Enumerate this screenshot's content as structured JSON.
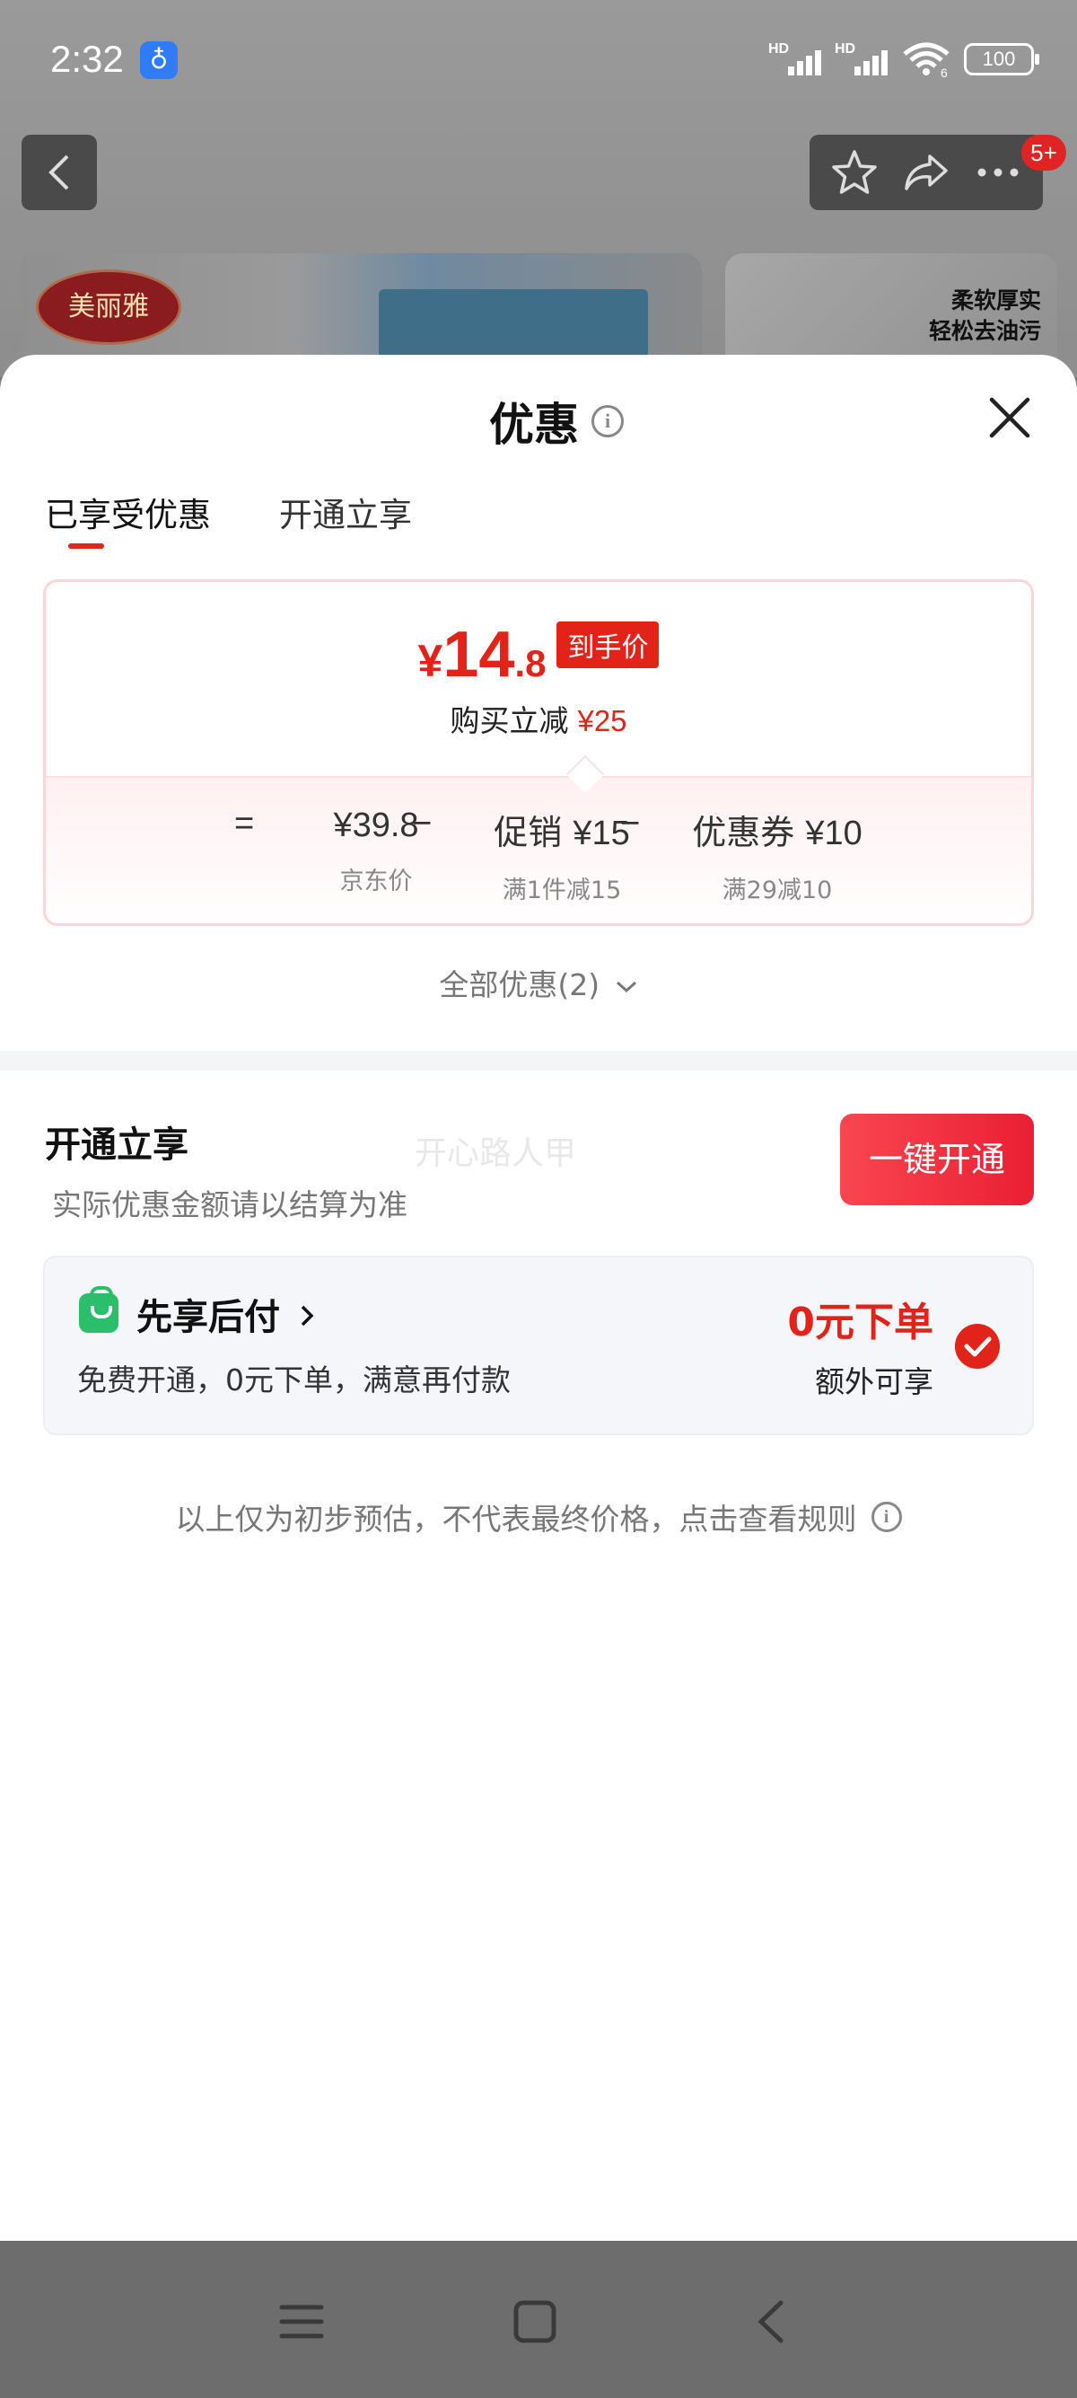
{
  "status_bar": {
    "time": "2:32",
    "app_icon": "shield-app-icon",
    "signal1_label": "HD",
    "signal2_label": "HD",
    "wifi_label": "6",
    "battery": "100"
  },
  "product_page": {
    "badge_count": "5+",
    "brand_logo_text": "美丽雅",
    "banner_right_line1": "柔软厚实",
    "banner_right_line2": "轻松去油污"
  },
  "sheet": {
    "title": "优惠",
    "tabs": [
      {
        "label": "已享受优惠",
        "active": true
      },
      {
        "label": "开通立享",
        "active": false
      }
    ],
    "final_price": {
      "yen": "¥",
      "int": "14",
      "dec": ".8",
      "tag": "到手价"
    },
    "save": {
      "label": "购买立减",
      "amount": "¥25"
    },
    "breakdown": {
      "equals": "=",
      "minus1": "−",
      "minus2": "−",
      "items": [
        {
          "value": "¥39.8",
          "sub": "京东价"
        },
        {
          "value_label": "促销",
          "value": "¥15",
          "sub": "满1件减15"
        },
        {
          "value_label": "优惠券",
          "value": "¥10",
          "sub": "满29减10"
        }
      ]
    },
    "all_offers": "全部优惠(2)",
    "open_section": {
      "title": "开通立享",
      "subtitle": "实际优惠金额请以结算为准",
      "watermark": "开心路人甲",
      "button": "一键开通"
    },
    "pay_later": {
      "title": "先享后付",
      "desc": "免费开通，0元下单，满意再付款",
      "price": "0元下单",
      "extra": "额外可享",
      "checked": true
    },
    "disclaimer": "以上仅为初步预估，不代表最终价格，点击查看规则"
  },
  "colors": {
    "accent_red": "#e2231a",
    "green": "#2bbf6b"
  }
}
